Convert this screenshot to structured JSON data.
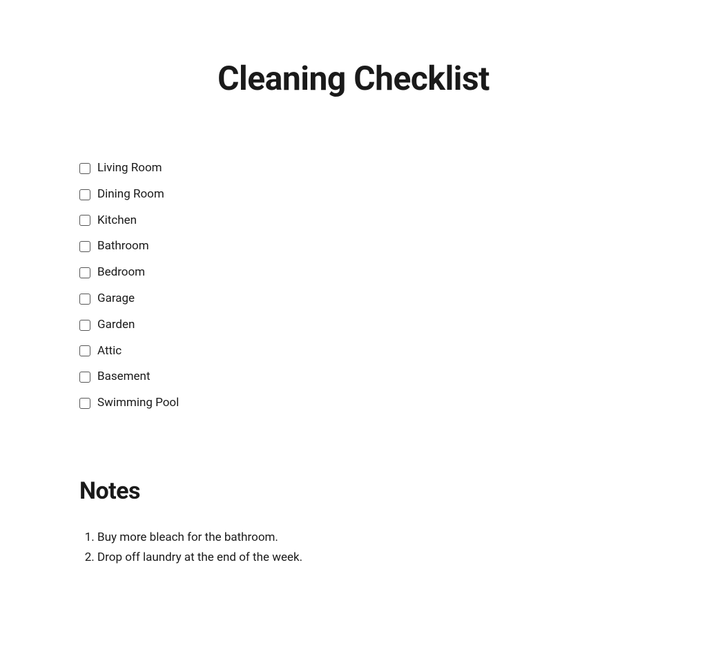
{
  "title": "Cleaning Checklist",
  "checklist": {
    "items": [
      {
        "label": "Living Room",
        "checked": false
      },
      {
        "label": "Dining Room",
        "checked": false
      },
      {
        "label": "Kitchen",
        "checked": false
      },
      {
        "label": "Bathroom",
        "checked": false
      },
      {
        "label": "Bedroom",
        "checked": false
      },
      {
        "label": "Garage",
        "checked": false
      },
      {
        "label": "Garden",
        "checked": false
      },
      {
        "label": "Attic",
        "checked": false
      },
      {
        "label": "Basement",
        "checked": false
      },
      {
        "label": "Swimming Pool",
        "checked": false
      }
    ]
  },
  "notes": {
    "heading": "Notes",
    "items": [
      "Buy more bleach for the bathroom.",
      "Drop off laundry at the end of the week."
    ]
  }
}
